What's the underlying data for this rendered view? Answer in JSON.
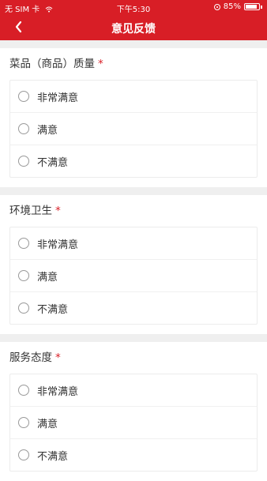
{
  "status_bar": {
    "carrier": "无 SIM 卡",
    "time": "下午5:30",
    "battery": "85%",
    "battery_level": 0.85
  },
  "nav": {
    "title": "意见反馈"
  },
  "sections": [
    {
      "title": "菜品（商品）质量",
      "required": "*",
      "options": [
        "非常满意",
        "满意",
        "不满意"
      ]
    },
    {
      "title": "环境卫生",
      "required": "*",
      "options": [
        "非常满意",
        "满意",
        "不满意"
      ]
    },
    {
      "title": "服务态度",
      "required": "*",
      "options": [
        "非常满意",
        "满意",
        "不满意"
      ]
    }
  ],
  "icons": {
    "back": "chevron-left-icon",
    "wifi": "wifi-icon",
    "lock": "rotation-lock-icon",
    "battery": "battery-icon"
  },
  "colors": {
    "brand": "#d81e26",
    "required": "#d81e26"
  }
}
